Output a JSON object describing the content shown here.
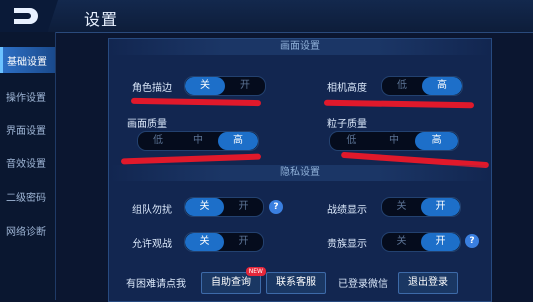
{
  "header": {
    "title": "设置"
  },
  "sidebar": {
    "items": [
      {
        "label": "基础设置",
        "active": true
      },
      {
        "label": "操作设置",
        "active": false
      },
      {
        "label": "界面设置",
        "active": false
      },
      {
        "label": "音效设置",
        "active": false
      },
      {
        "label": "二级密码",
        "active": false
      },
      {
        "label": "网络诊断",
        "active": false
      }
    ]
  },
  "graphics": {
    "section_title": "画面设置",
    "char_outline": {
      "label": "角色描边",
      "options": [
        "关",
        "开"
      ],
      "selected": "关"
    },
    "camera_height": {
      "label": "相机高度",
      "options": [
        "低",
        "高"
      ],
      "selected": "高"
    },
    "image_quality": {
      "label": "画面质量",
      "options": [
        "低",
        "中",
        "高"
      ],
      "selected": "高"
    },
    "particle_quality": {
      "label": "粒子质量",
      "options": [
        "低",
        "中",
        "高"
      ],
      "selected": "高"
    }
  },
  "privacy": {
    "section_title": "隐私设置",
    "team_dnd": {
      "label": "组队勿扰",
      "options": [
        "关",
        "开"
      ],
      "selected": "关"
    },
    "battle_display": {
      "label": "战绩显示",
      "options": [
        "关",
        "开"
      ],
      "selected": "开"
    },
    "allow_spectate": {
      "label": "允许观战",
      "options": [
        "关",
        "开"
      ],
      "selected": "关"
    },
    "noble_display": {
      "label": "贵族显示",
      "options": [
        "关",
        "开"
      ],
      "selected": "开"
    }
  },
  "footer": {
    "help_text": "有困难请点我",
    "self_query": "自助查询",
    "new_badge": "NEW",
    "contact": "联系客服",
    "wechat_status": "已登录微信",
    "logout": "退出登录"
  },
  "icons": {
    "help": "question-icon",
    "logo": "d-logo-icon"
  },
  "colors": {
    "accent": "#1d6fc9",
    "highlight": "#e0192b"
  }
}
